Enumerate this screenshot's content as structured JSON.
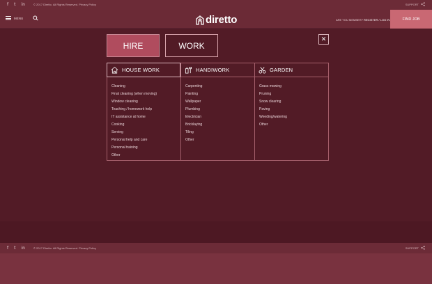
{
  "topbar": {
    "social": [
      "f",
      "t",
      "in"
    ],
    "copyright": "© 2017 Diretto. All Rights Reserved. Privacy Policy",
    "support": "SUPPORT"
  },
  "header": {
    "menu_label": "MENU",
    "logo_text": "diretto",
    "member_text": "ARE YOU MEMBER?",
    "register_login": "REGISTER / LOG IN",
    "find_job": "FIND JOB"
  },
  "tabs": {
    "hire": "HIRE",
    "work": "WORK"
  },
  "close": "✕",
  "categories": [
    {
      "title": "HOUSE WORK",
      "icon": "house-icon",
      "items": [
        "Cleaning",
        "Final cleaning (when moving)",
        "Window cleaning",
        "Teaching / homework help",
        "IT assistance at home",
        "Cooking",
        "Serving",
        "Personal help and care",
        "Personal training",
        "Other"
      ]
    },
    {
      "title": "HANDIWORK",
      "icon": "tools-icon",
      "items": [
        "Carpenting",
        "Painting",
        "Wallpaper",
        "Plumbing",
        "Electrician",
        "Bricklaying",
        "Tiling",
        "Other"
      ]
    },
    {
      "title": "GARDEN",
      "icon": "shears-icon",
      "items": [
        "Grass mowing",
        "Pruning",
        "Snow clearing",
        "Paving",
        "Weeding/watering",
        "Other"
      ]
    }
  ],
  "footer": {
    "social": [
      "f",
      "t",
      "in"
    ],
    "copyright": "© 2017 Diretto. All Rights Reserved. Privacy Policy",
    "support": "SUPPORT"
  },
  "colors": {
    "accent": "#c96873",
    "hire_tab": "#b04c5e",
    "overlay": "#521b26",
    "header": "#6b2a36"
  }
}
